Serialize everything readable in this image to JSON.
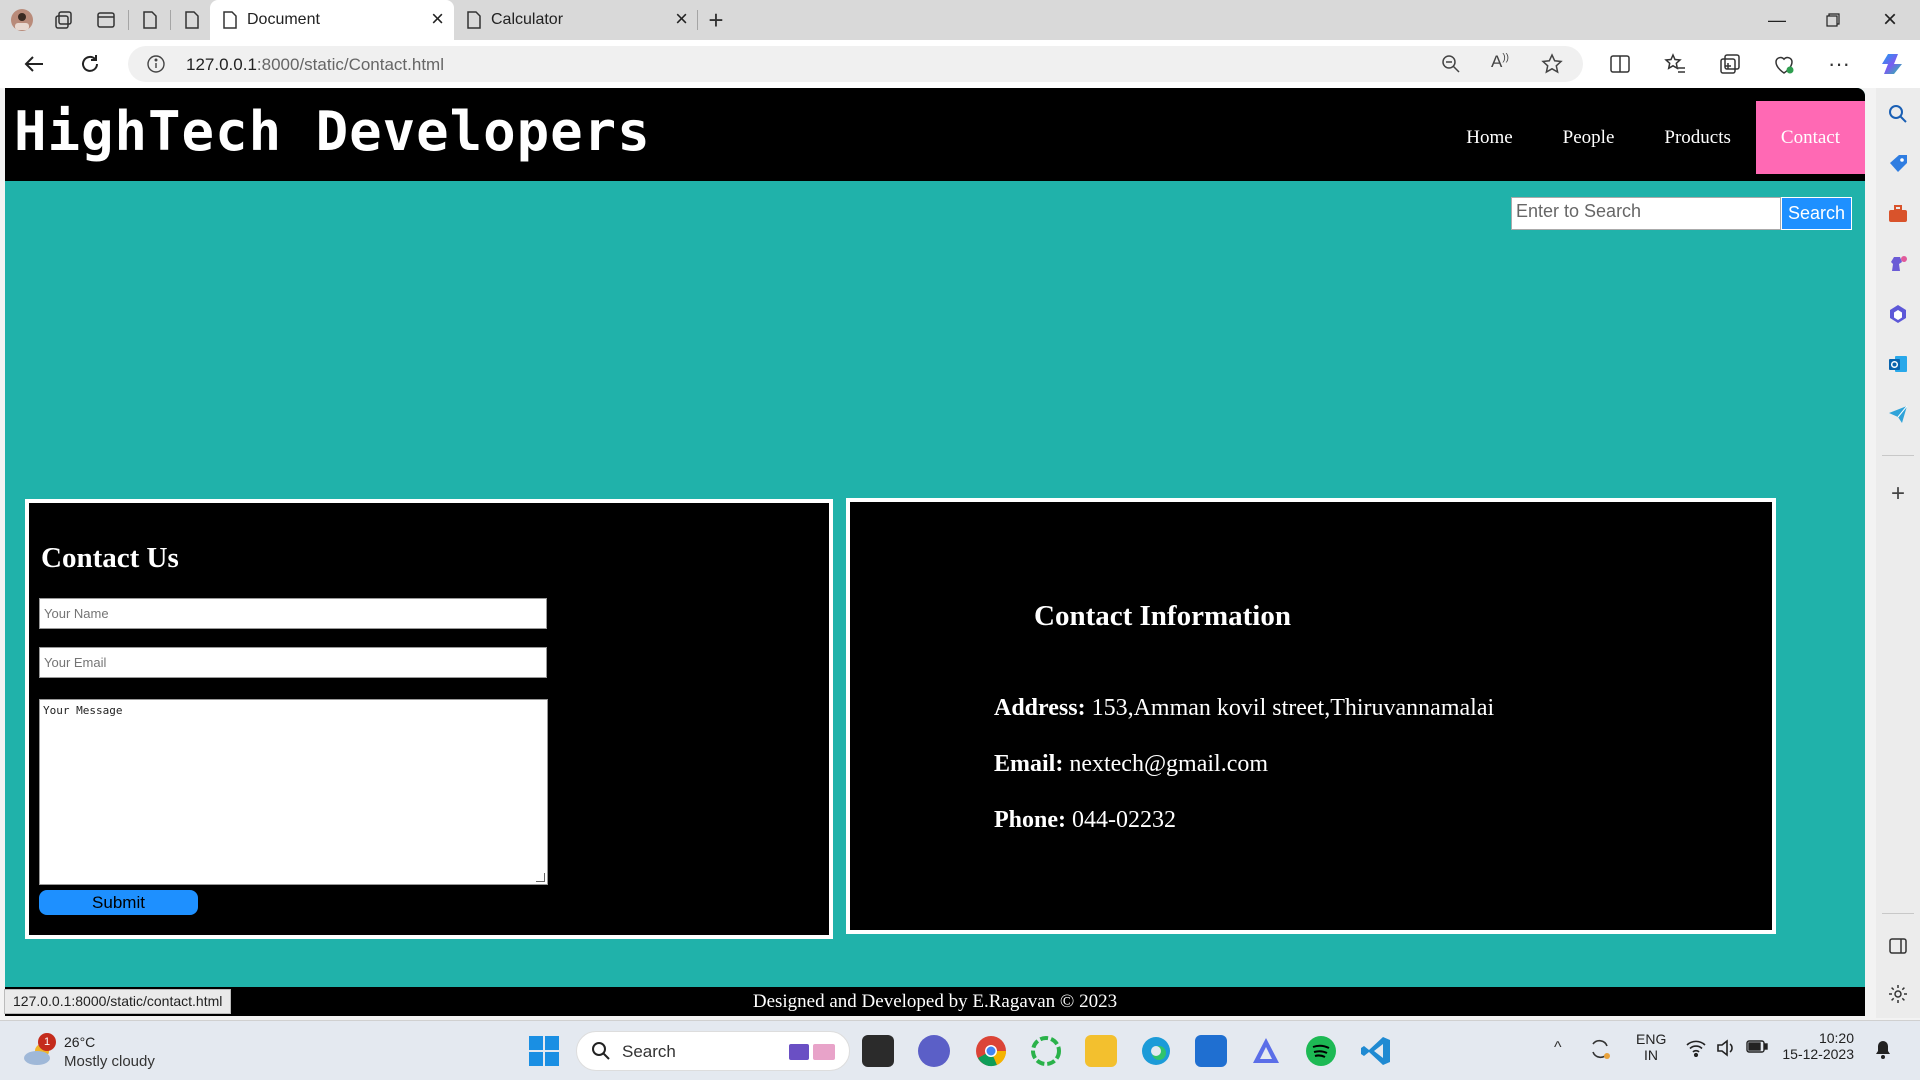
{
  "browser": {
    "tabs": [
      {
        "title": "Document",
        "active": true
      },
      {
        "title": "Calculator",
        "active": false
      }
    ],
    "address": {
      "host": "127.0.0.1",
      "path": ":8000/static/Contact.html"
    },
    "status_url": "127.0.0.1:8000/static/contact.html"
  },
  "site": {
    "brand": "HighTech Developers",
    "nav": [
      {
        "label": "Home",
        "active": false
      },
      {
        "label": "People",
        "active": false
      },
      {
        "label": "Products",
        "active": false
      },
      {
        "label": "Contact",
        "active": true
      }
    ],
    "search": {
      "placeholder": "Enter to Search",
      "button": "Search"
    }
  },
  "contact_form": {
    "title": "Contact Us",
    "name_placeholder": "Your Name",
    "email_placeholder": "Your Email",
    "message_placeholder": "Your Message",
    "submit": "Submit"
  },
  "contact_info": {
    "title": "Contact Information",
    "address_label": "Address:",
    "address": "153,Amman kovil street,Thiruvannamalai",
    "email_label": "Email:",
    "email": "nextech@gmail.com",
    "phone_label": "Phone:",
    "phone": "044-02232"
  },
  "footer": {
    "text": "Designed and Developed by E.Ragavan © 2023"
  },
  "taskbar": {
    "weather": {
      "temp": "26°C",
      "desc": "Mostly cloudy",
      "badge": "1"
    },
    "search": "Search",
    "lang": {
      "line1": "ENG",
      "line2": "IN"
    },
    "clock": {
      "time": "10:20",
      "date": "15-12-2023"
    }
  },
  "colors": {
    "page_bg": "#20b2aa",
    "active_nav": "#ff69b4",
    "button": "#1e90ff"
  }
}
